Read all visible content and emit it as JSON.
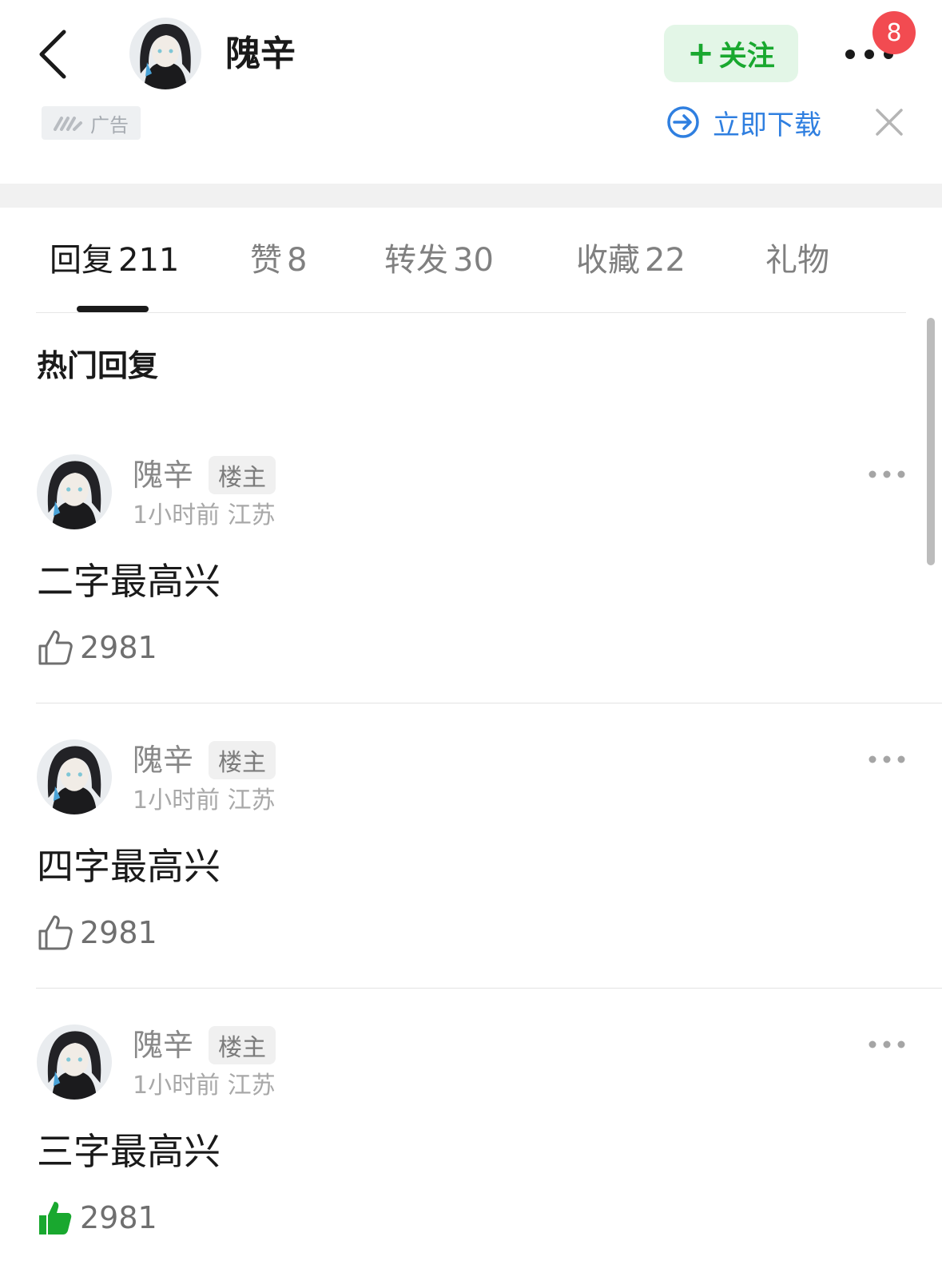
{
  "header": {
    "user_name": "隗辛",
    "follow_label": "关注",
    "follow_plus": "+",
    "notification_count": "8"
  },
  "ad": {
    "tag_label": "广告",
    "download_label": "立即下载"
  },
  "tabs": [
    {
      "label": "回复",
      "count": "211",
      "active": true
    },
    {
      "label": "赞",
      "count": "8"
    },
    {
      "label": "转发",
      "count": "30"
    },
    {
      "label": "收藏",
      "count": "22"
    },
    {
      "label": "礼物",
      "count": ""
    }
  ],
  "section_title": "热门回复",
  "comments": [
    {
      "author": "隗辛",
      "badge": "楼主",
      "time": "1小时前",
      "location": "江苏",
      "text": "二字最高兴",
      "likes": "2981",
      "liked": false
    },
    {
      "author": "隗辛",
      "badge": "楼主",
      "time": "1小时前",
      "location": "江苏",
      "text": "四字最高兴",
      "likes": "2981",
      "liked": false
    },
    {
      "author": "隗辛",
      "badge": "楼主",
      "time": "1小时前",
      "location": "江苏",
      "text": "三字最高兴",
      "likes": "2981",
      "liked": true
    }
  ],
  "colors": {
    "accent_green": "#19a82f",
    "follow_bg": "#e3f6e7",
    "link_blue": "#2f7fe0",
    "badge_red": "#f24b51"
  }
}
